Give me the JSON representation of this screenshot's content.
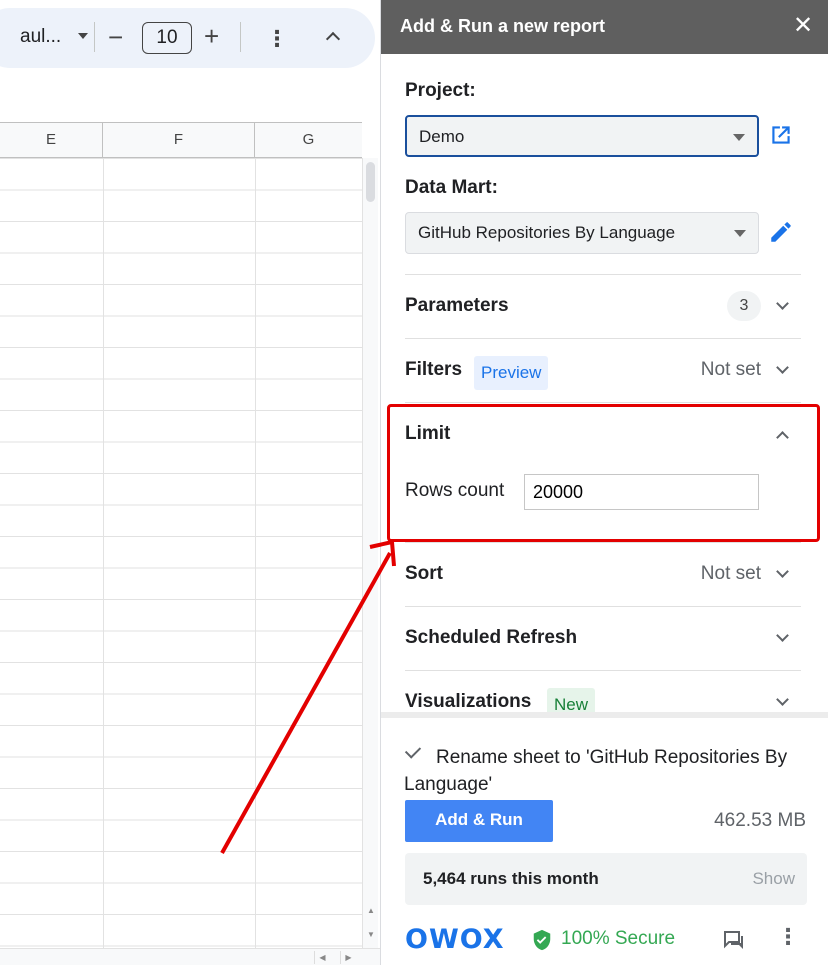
{
  "sheet": {
    "font_name": "aul...",
    "font_size": "10",
    "columns": [
      "E",
      "F",
      "G"
    ]
  },
  "panel": {
    "title": "Add & Run a new report",
    "project": {
      "label": "Project:",
      "value": "Demo"
    },
    "data_mart": {
      "label": "Data Mart:",
      "value": "GitHub Repositories By Language"
    },
    "sections": {
      "parameters": {
        "title": "Parameters",
        "count": "3"
      },
      "filters": {
        "title": "Filters",
        "tag": "Preview",
        "value": "Not set"
      },
      "limit": {
        "title": "Limit",
        "rows_label": "Rows count",
        "rows_value": "20000"
      },
      "sort": {
        "title": "Sort",
        "value": "Not set"
      },
      "scheduled_refresh": {
        "title": "Scheduled Refresh"
      },
      "visualizations": {
        "title": "Visualizations",
        "tag": "New"
      }
    },
    "footer": {
      "rename_label": "Rename sheet to 'GitHub Repositories By Language'",
      "rename_checked": true,
      "add_run_label": "Add & Run",
      "size": "462.53 MB",
      "runs": "5,464 runs this month",
      "show_label": "Show",
      "brand": "OWOX",
      "secure_label": "100% Secure"
    }
  },
  "colors": {
    "header_bg": "#5f5f5f",
    "primary_button": "#4285f4",
    "highlight": "#e30000",
    "secure_green": "#34a853",
    "preview_tag": "#1a73e8",
    "new_tag": "#188038"
  }
}
